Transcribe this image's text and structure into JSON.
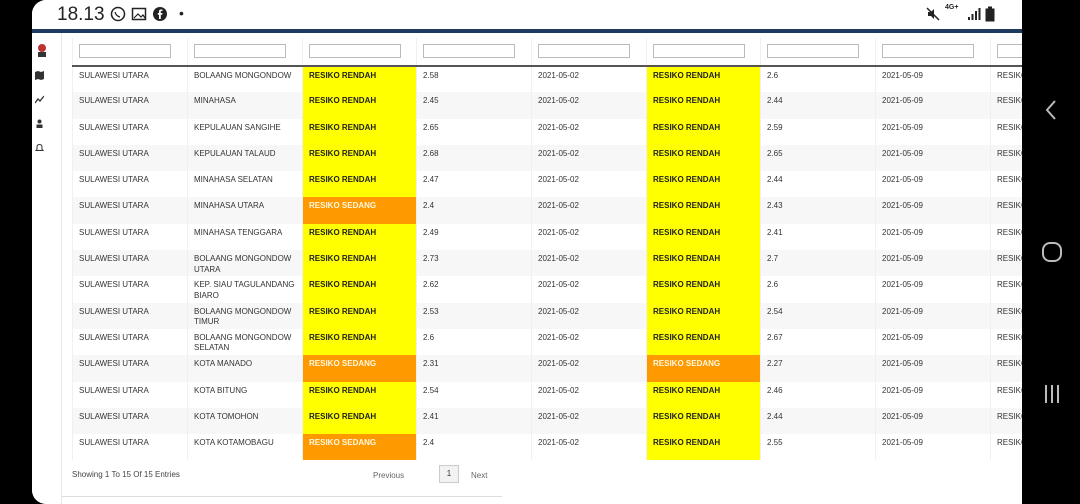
{
  "status_bar": {
    "time": "18.13",
    "net_label": "4G+",
    "more": "•"
  },
  "table": {
    "rows": [
      {
        "province": "SULAWESI UTARA",
        "district": "BOLAANG MONGONDOW",
        "risk1": "RESIKO RENDAH",
        "score1": "2.58",
        "date1": "2021-05-02",
        "risk2": "RESIKO RENDAH",
        "score2": "2.6",
        "date2": "2021-05-09",
        "risk3": "RESIKO RESIKO"
      },
      {
        "province": "SULAWESI UTARA",
        "district": "MINAHASA",
        "risk1": "RESIKO RENDAH",
        "score1": "2.45",
        "date1": "2021-05-02",
        "risk2": "RESIKO RENDAH",
        "score2": "2.44",
        "date2": "2021-05-09",
        "risk3": "RESIKO RESIKO"
      },
      {
        "province": "SULAWESI UTARA",
        "district": "KEPULAUAN SANGIHE",
        "risk1": "RESIKO RENDAH",
        "score1": "2.65",
        "date1": "2021-05-02",
        "risk2": "RESIKO RENDAH",
        "score2": "2.59",
        "date2": "2021-05-09",
        "risk3": "RESIKO RESIKO"
      },
      {
        "province": "SULAWESI UTARA",
        "district": "KEPULAUAN TALAUD",
        "risk1": "RESIKO RENDAH",
        "score1": "2.68",
        "date1": "2021-05-02",
        "risk2": "RESIKO RENDAH",
        "score2": "2.65",
        "date2": "2021-05-09",
        "risk3": "RESIKO RESIKO"
      },
      {
        "province": "SULAWESI UTARA",
        "district": "MINAHASA SELATAN",
        "risk1": "RESIKO RENDAH",
        "score1": "2.47",
        "date1": "2021-05-02",
        "risk2": "RESIKO RENDAH",
        "score2": "2.44",
        "date2": "2021-05-09",
        "risk3": "RESIKO RESIKO"
      },
      {
        "province": "SULAWESI UTARA",
        "district": "MINAHASA UTARA",
        "risk1": "RESIKO SEDANG",
        "score1": "2.4",
        "date1": "2021-05-02",
        "risk2": "RESIKO RENDAH",
        "score2": "2.43",
        "date2": "2021-05-09",
        "risk3": "RESIKO RENDAI"
      },
      {
        "province": "SULAWESI UTARA",
        "district": "MINAHASA TENGGARA",
        "risk1": "RESIKO RENDAH",
        "score1": "2.49",
        "date1": "2021-05-02",
        "risk2": "RESIKO RENDAH",
        "score2": "2.41",
        "date2": "2021-05-09",
        "risk3": "RESIKO RESIKO"
      },
      {
        "province": "SULAWESI UTARA",
        "district": "BOLAANG MONGONDOW UTARA",
        "risk1": "RESIKO RENDAH",
        "score1": "2.73",
        "date1": "2021-05-02",
        "risk2": "RESIKO RENDAH",
        "score2": "2.7",
        "date2": "2021-05-09",
        "risk3": "RESIKO RESIKO"
      },
      {
        "province": "SULAWESI UTARA",
        "district": "KEP. SIAU TAGULANDANG BIARO",
        "risk1": "RESIKO RENDAH",
        "score1": "2.62",
        "date1": "2021-05-02",
        "risk2": "RESIKO RENDAH",
        "score2": "2.6",
        "date2": "2021-05-09",
        "risk3": "RESIKO RESIKO"
      },
      {
        "province": "SULAWESI UTARA",
        "district": "BOLAANG MONGONDOW TIMUR",
        "risk1": "RESIKO RENDAH",
        "score1": "2.53",
        "date1": "2021-05-02",
        "risk2": "RESIKO RENDAH",
        "score2": "2.54",
        "date2": "2021-05-09",
        "risk3": "RESIKO RESIKO"
      },
      {
        "province": "SULAWESI UTARA",
        "district": "BOLAANG MONGONDOW SELATAN",
        "risk1": "RESIKO RENDAH",
        "score1": "2.6",
        "date1": "2021-05-02",
        "risk2": "RESIKO RENDAH",
        "score2": "2.67",
        "date2": "2021-05-09",
        "risk3": "RESIKO RESIKO"
      },
      {
        "province": "SULAWESI UTARA",
        "district": "KOTA MANADO",
        "risk1": "RESIKO SEDANG",
        "score1": "2.31",
        "date1": "2021-05-02",
        "risk2": "RESIKO SEDANG",
        "score2": "2.27",
        "date2": "2021-05-09",
        "risk3": "RESIKO SEDANG"
      },
      {
        "province": "SULAWESI UTARA",
        "district": "KOTA BITUNG",
        "risk1": "RESIKO RENDAH",
        "score1": "2.54",
        "date1": "2021-05-02",
        "risk2": "RESIKO RENDAH",
        "score2": "2.46",
        "date2": "2021-05-09",
        "risk3": "RESIKO RESIKO"
      },
      {
        "province": "SULAWESI UTARA",
        "district": "KOTA TOMOHON",
        "risk1": "RESIKO RENDAH",
        "score1": "2.41",
        "date1": "2021-05-02",
        "risk2": "RESIKO RENDAH",
        "score2": "2.44",
        "date2": "2021-05-09",
        "risk3": "RESIKO RESIKO"
      },
      {
        "province": "SULAWESI UTARA",
        "district": "KOTA KOTAMOBAGU",
        "risk1": "RESIKO SEDANG",
        "score1": "2.4",
        "date1": "2021-05-02",
        "risk2": "RESIKO RENDAH",
        "score2": "2.55",
        "date2": "2021-05-09",
        "risk3": "RESIKO RENDAI"
      }
    ]
  },
  "colors": {
    "rendah": "#ffff00",
    "sedang": "#ff9900",
    "header_line": "#1f3a5f"
  },
  "footer": {
    "info": "Showing 1 To 15 Of 15 Entries",
    "previous": "Previous",
    "current_page": "1",
    "next": "Next"
  }
}
